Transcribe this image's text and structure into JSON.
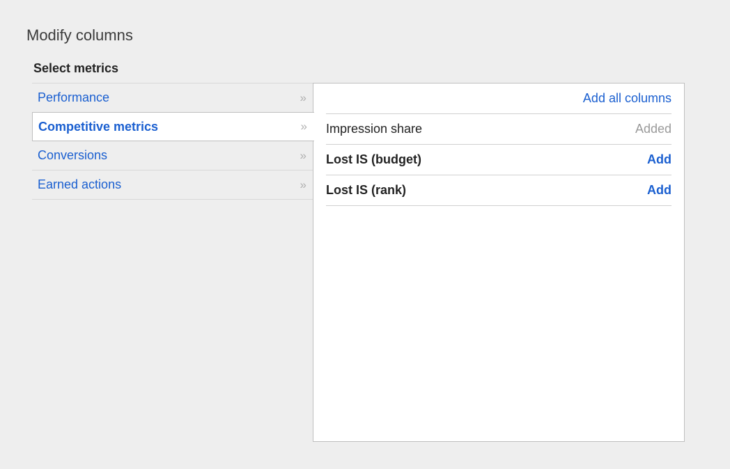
{
  "page_title": "Modify columns",
  "section_title": "Select metrics",
  "categories": [
    {
      "label": "Performance",
      "active": false
    },
    {
      "label": "Competitive metrics",
      "active": true
    },
    {
      "label": "Conversions",
      "active": false
    },
    {
      "label": "Earned actions",
      "active": false
    }
  ],
  "add_all_label": "Add all columns",
  "metrics": [
    {
      "label": "Impression share",
      "bold": false,
      "action": "Added",
      "action_type": "added"
    },
    {
      "label": "Lost IS (budget)",
      "bold": true,
      "action": "Add",
      "action_type": "add"
    },
    {
      "label": "Lost IS (rank)",
      "bold": true,
      "action": "Add",
      "action_type": "add"
    }
  ]
}
